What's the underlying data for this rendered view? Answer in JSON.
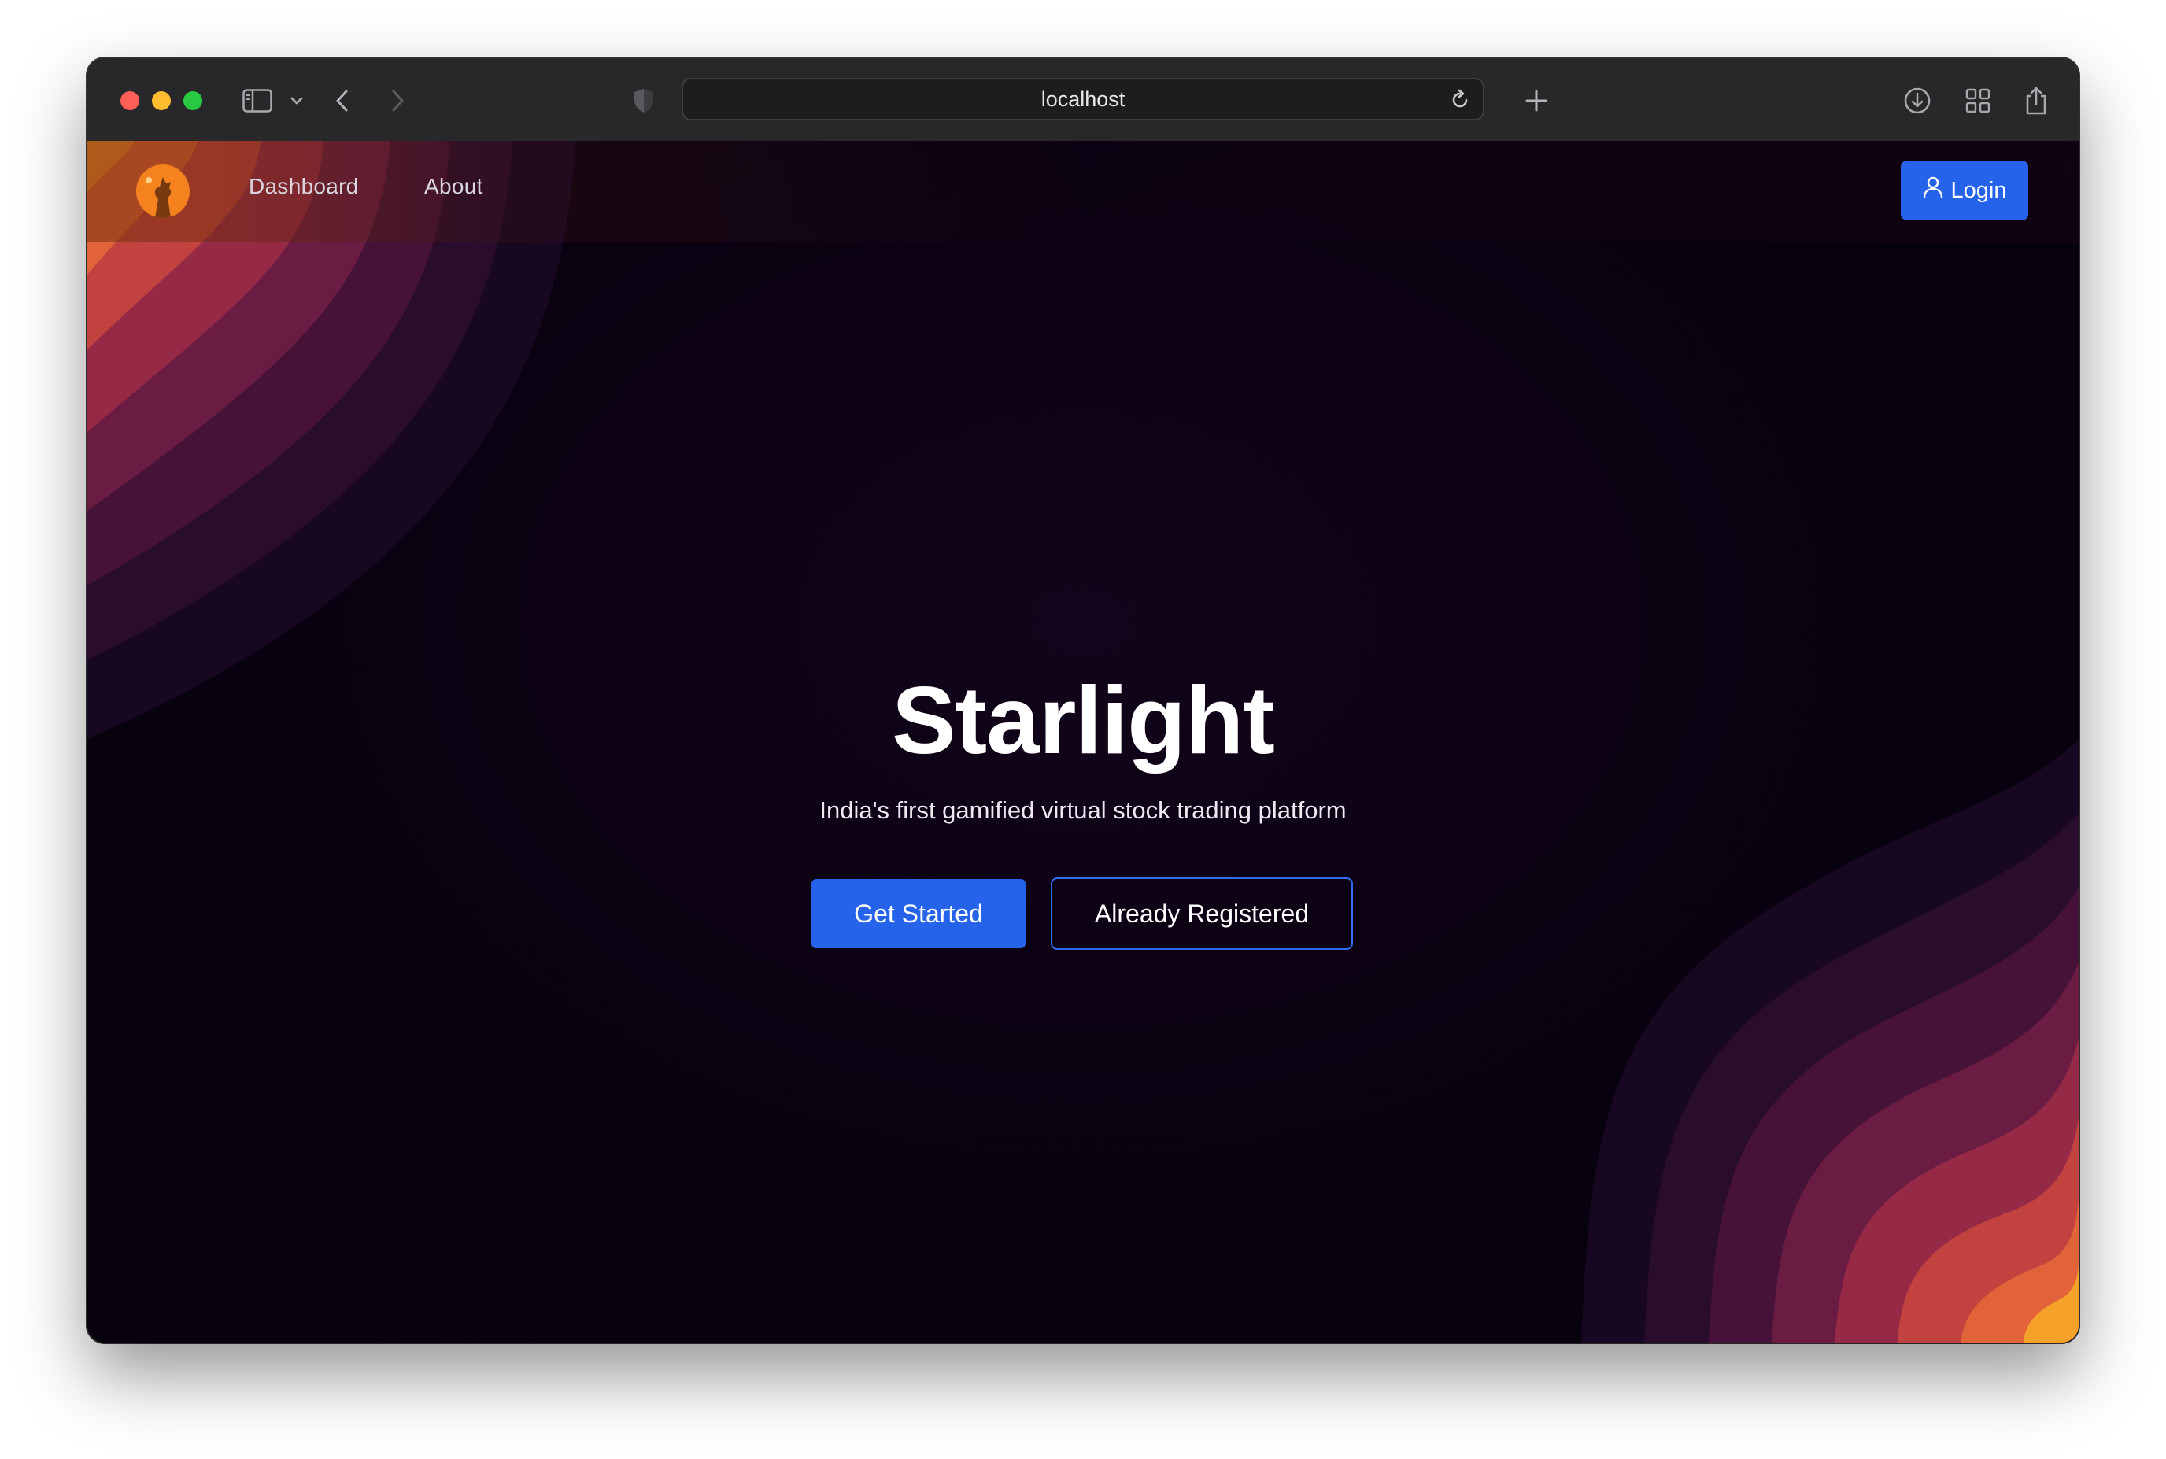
{
  "browser": {
    "url": "localhost",
    "icons": [
      "sidebar-icon",
      "chevron-down-icon",
      "back-icon",
      "forward-icon",
      "shield-icon",
      "reload-icon",
      "new-tab-icon",
      "download-icon",
      "tabs-overview-icon",
      "share-icon"
    ]
  },
  "navbar": {
    "logo_icon": "wolf-logo-icon",
    "links": [
      {
        "label": "Dashboard"
      },
      {
        "label": "About"
      }
    ],
    "login_label": "Login",
    "login_icon": "user-icon"
  },
  "hero": {
    "title": "Starlight",
    "subtitle": "India's first gamified virtual stock trading platform",
    "primary_button": "Get Started",
    "secondary_button": "Already Registered"
  },
  "colors": {
    "accent": "#2563eb",
    "background": "#07010f",
    "wave_bands": [
      "#f6a12a",
      "#f08a2c",
      "#e2633a",
      "#c2423f",
      "#962a46",
      "#6b1c43",
      "#461238",
      "#2a0c2c",
      "#170720"
    ]
  }
}
